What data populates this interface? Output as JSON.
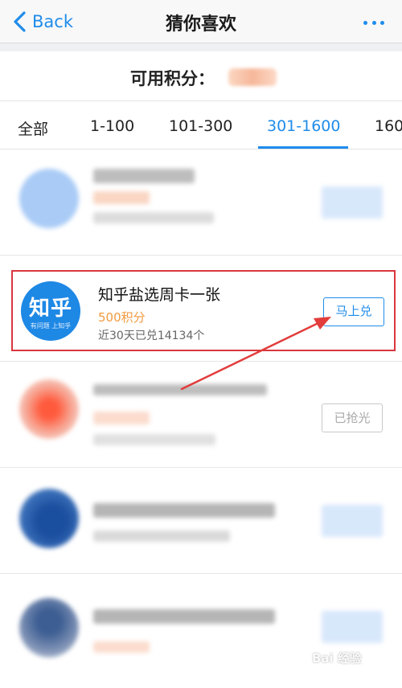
{
  "nav": {
    "back_label": "Back",
    "title": "猜你喜欢"
  },
  "points": {
    "label": "可用积分："
  },
  "tabs": [
    {
      "label": "全部"
    },
    {
      "label": "1-100"
    },
    {
      "label": "101-300"
    },
    {
      "label": "301-1600",
      "active": true
    },
    {
      "label": "160"
    }
  ],
  "featured_item": {
    "logo_main": "知乎",
    "logo_tagline": "有问题 上知乎",
    "title": "知乎盐选周卡一张",
    "points": "500积分",
    "redeemed": "近30天已兑14134个",
    "button_label": "马上兑"
  },
  "soldout_button_label": "已抢光",
  "watermark": "Bai 经验",
  "colors": {
    "accent": "#1f8ceb",
    "highlight": "#d9363e",
    "price": "#f19a3e"
  }
}
